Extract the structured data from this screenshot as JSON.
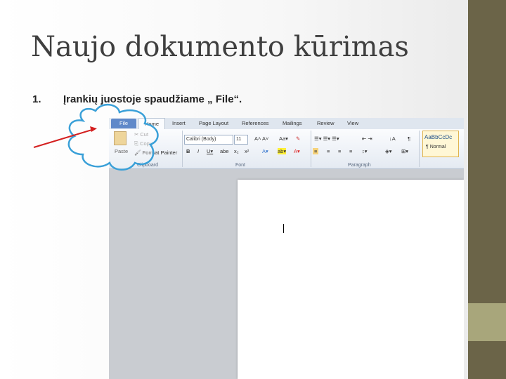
{
  "slide": {
    "title": "Naujo dokumento kūrimas",
    "bullet_number": "1.",
    "bullet_text": "Įrankių juostoje spaudžiame „ File“."
  },
  "word": {
    "tabs": [
      "File",
      "Home",
      "Insert",
      "Page Layout",
      "References",
      "Mailings",
      "Review",
      "View"
    ],
    "clipboard": {
      "paste": "Paste",
      "cut": "Cut",
      "copy": "Copy",
      "format_painter": "Format Painter",
      "label": "Clipboard"
    },
    "font": {
      "name": "Calibri (Body)",
      "size": "11",
      "label": "Font"
    },
    "paragraph_label": "Paragraph",
    "style_preview": "AaBbCcDc",
    "style_name": "¶ Normal"
  },
  "colors": {
    "side_bar": "#6b6448",
    "side_stripe": "#a8a67b",
    "arrow": "#d42020",
    "callout": "#3aa0d8",
    "file_tab": "#2b62b7"
  }
}
